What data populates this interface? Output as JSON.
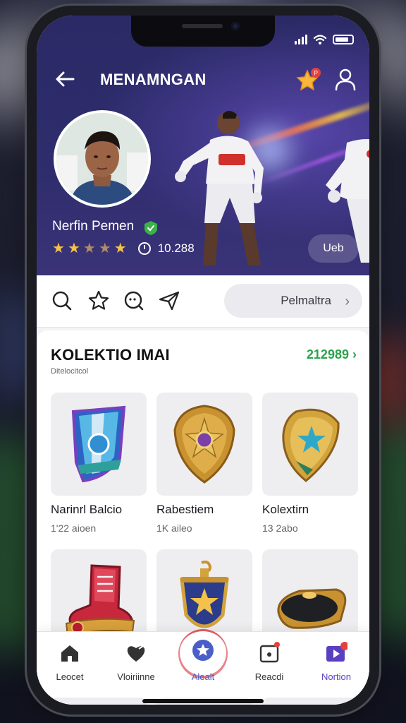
{
  "header": {
    "title": "MENAMNGAN",
    "player_name": "Nerfin Pemen",
    "rating_value": "10.288",
    "hero_button": "Ueb",
    "rating_stars": 3.5
  },
  "actions": {
    "pill_label": "Pelmaltra"
  },
  "collection": {
    "title": "KOLEKTIO IMAI",
    "subtitle": "Ditelocitcol",
    "count": "212989",
    "items": [
      {
        "name": "Narinrl Balcio",
        "meta": "1'22 aioen",
        "icon": "crest-shield-icon"
      },
      {
        "name": "Rabestiem",
        "meta": "1K aileo",
        "icon": "gold-medal-shield-icon"
      },
      {
        "name": "Kolextirn",
        "meta": "13 2abo",
        "icon": "gold-star-shield-icon"
      },
      {
        "name": "",
        "meta": "",
        "icon": "red-boot-icon"
      },
      {
        "name": "",
        "meta": "",
        "icon": "pennant-shield-icon"
      },
      {
        "name": "",
        "meta": "",
        "icon": "gold-plaque-icon"
      }
    ]
  },
  "nav": {
    "items": [
      {
        "label": "Leocet",
        "icon": "home-icon"
      },
      {
        "label": "Vloiriinne",
        "icon": "heart-chat-icon"
      },
      {
        "label": "Alealt",
        "icon": "star-badge-icon"
      },
      {
        "label": "Reacdi",
        "icon": "camera-icon"
      },
      {
        "label": "Nortion",
        "icon": "play-icon"
      }
    ]
  },
  "colors": {
    "accent": "#4b5ec7",
    "count_green": "#2aa34a",
    "hero_bg": "#2b2a66",
    "notification": "#e4413c"
  }
}
